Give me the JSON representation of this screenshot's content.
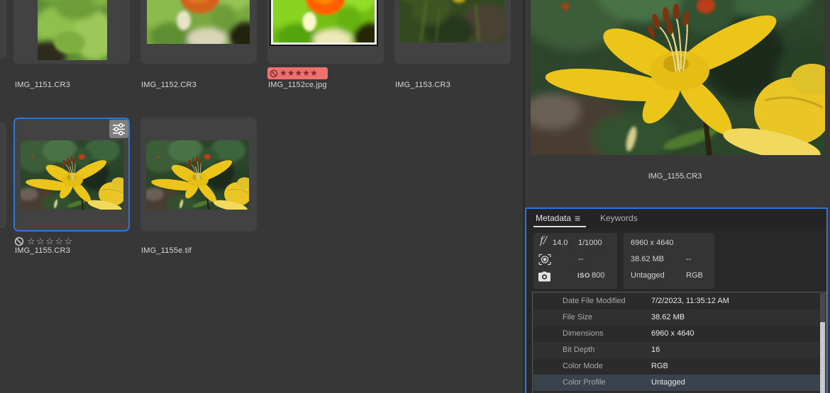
{
  "glyphs": {
    "stars_filled": "★★★★★",
    "stars_empty": "☆☆☆☆☆",
    "panel_menu": "≡"
  },
  "grid": {
    "items": [
      {
        "name": "IMG_1151.CR3"
      },
      {
        "name": "IMG_1152.CR3"
      },
      {
        "name": "IMG_1152ce.jpg",
        "rating": 5,
        "rejected": true
      },
      {
        "name": "IMG_1153.CR3"
      },
      {
        "name": "IMG_1155.CR3",
        "selected": true,
        "rating": 0,
        "has_settings": true
      },
      {
        "name": "IMG_1155e.tif"
      }
    ]
  },
  "preview": {
    "filename": "IMG_1155.CR3"
  },
  "metadata_panel": {
    "tabs": [
      {
        "label": "Metadata",
        "active": true
      },
      {
        "label": "Keywords",
        "active": false
      }
    ],
    "placard": {
      "aperture_label": "f/",
      "aperture": "14.0",
      "shutter": "1/1000",
      "exposure_comp": "--",
      "iso_label": "ISO",
      "iso": "800",
      "dimensions": "6960 x 4640",
      "file_size": "38.62 MB",
      "size_extra": "--",
      "color_profile": "Untagged",
      "color_mode": "RGB"
    },
    "rows": [
      {
        "label": "Date File Modified",
        "value": "7/2/2023, 11:35:12 AM"
      },
      {
        "label": "File Size",
        "value": "38.62 MB"
      },
      {
        "label": "Dimensions",
        "value": "6960 x 4640"
      },
      {
        "label": "Bit Depth",
        "value": "16"
      },
      {
        "label": "Color Mode",
        "value": "RGB"
      },
      {
        "label": "Color Profile",
        "value": "Untagged",
        "selected": true
      }
    ]
  },
  "colors": {
    "selection_accent": "#2e76d5",
    "reject_badge_bg": "#ef706d",
    "reject_badge_glyph": "#7e2b33",
    "selected_row_bg": "#39424d"
  }
}
